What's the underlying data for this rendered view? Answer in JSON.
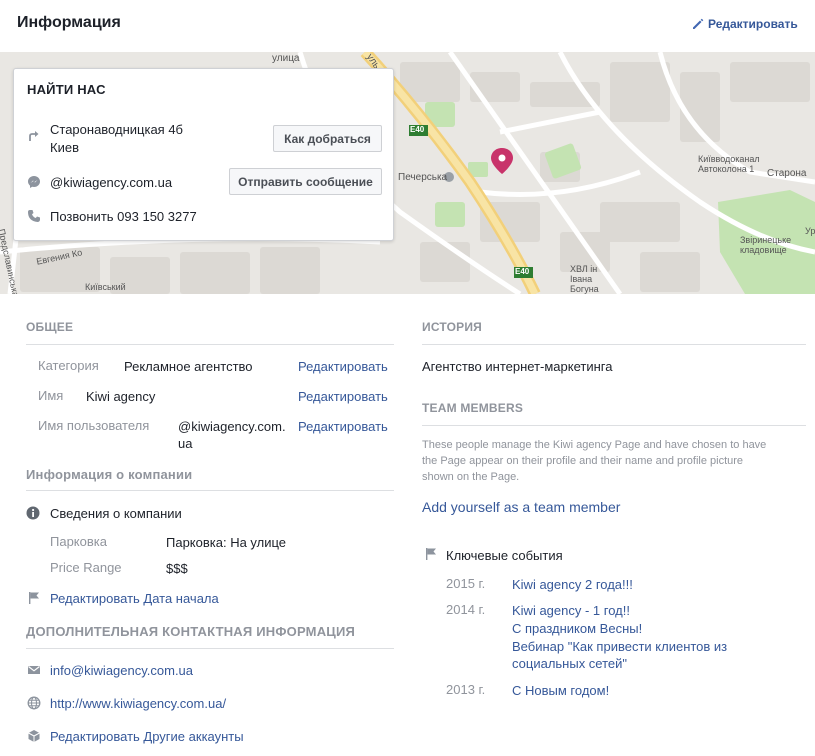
{
  "header": {
    "title": "Информация",
    "edit_label": "Редактировать"
  },
  "map": {
    "labels": {
      "e40_a": "E40",
      "e40_b": "E40",
      "pecherska": "Печерська",
      "kyivvodokanal": "Київводоканал Автоколона 1",
      "starona": "Старона",
      "zvirynetske": "Звіринецьке кладовище",
      "khvl": "ХВЛ ін Івана Богуна",
      "kyivskyi": "Київський",
      "vulytsia": "улица",
      "yevhena": "Евгения Ко",
      "predslavynska": "Предславинська",
      "ulr": "уль",
      "ur": "Ур"
    }
  },
  "find_us": {
    "title": "НАЙТИ НАС",
    "address_line1": "Старонаводницкая 4б",
    "address_line2": "Киев",
    "directions_button": "Как добраться",
    "messenger": "@kiwiagency.com.ua",
    "message_button": "Отправить сообщение",
    "phone": "Позвонить 093 150 3277"
  },
  "general": {
    "heading": "ОБЩЕЕ",
    "rows": [
      {
        "label": "Категория",
        "value": "Рекламное агентство",
        "action": "Редактировать"
      },
      {
        "label": "Имя",
        "value": "Kiwi agency",
        "action": "Редактировать"
      },
      {
        "label": "Имя пользователя",
        "value_line1": "@kiwiagency.com.",
        "value_line2": "ua",
        "action": "Редактировать"
      }
    ]
  },
  "company_info": {
    "heading": "Информация о компании",
    "details_title": "Сведения о компании",
    "parking_label": "Парковка",
    "parking_value": "Парковка: На улице",
    "price_label": "Price Range",
    "price_value": "$$$",
    "edit_start_date": "Редактировать Дата начала"
  },
  "extra_contacts": {
    "heading": "ДОПОЛНИТЕЛЬНАЯ КОНТАКТНАЯ ИНФОРМАЦИЯ",
    "email": "info@kiwiagency.com.ua",
    "website": "http://www.kiwiagency.com.ua/",
    "other_accounts": "Редактировать Другие аккаунты"
  },
  "history": {
    "heading": "ИСТОРИЯ",
    "text": "Агентство интернет-маркетинга"
  },
  "team": {
    "heading": "TEAM MEMBERS",
    "desc_line1": "These people manage the Kiwi agency Page and have chosen to have",
    "desc_line2": "the Page appear on their profile and their name and profile picture",
    "desc_line3": "shown on the Page.",
    "add_link": "Add yourself as a team member"
  },
  "milestones": {
    "heading": "Ключевые события",
    "items": [
      {
        "year": "2015 г.",
        "lines": [
          "Kiwi agency 2 года!!!"
        ]
      },
      {
        "year": "2014 г.",
        "lines": [
          "Kiwi agency - 1 год!!",
          "С праздником Весны!",
          "Вебинар \"Как привести клиентов из",
          "социальных сетей\""
        ]
      },
      {
        "year": "2013 г.",
        "lines": [
          "С Новым годом!"
        ]
      }
    ]
  },
  "colors": {
    "link": "#365899",
    "muted": "#90949c",
    "text": "#1d2129",
    "map_road": "#f5d98b",
    "map_green": "#b9dfa6",
    "pin": "#c8336a"
  }
}
